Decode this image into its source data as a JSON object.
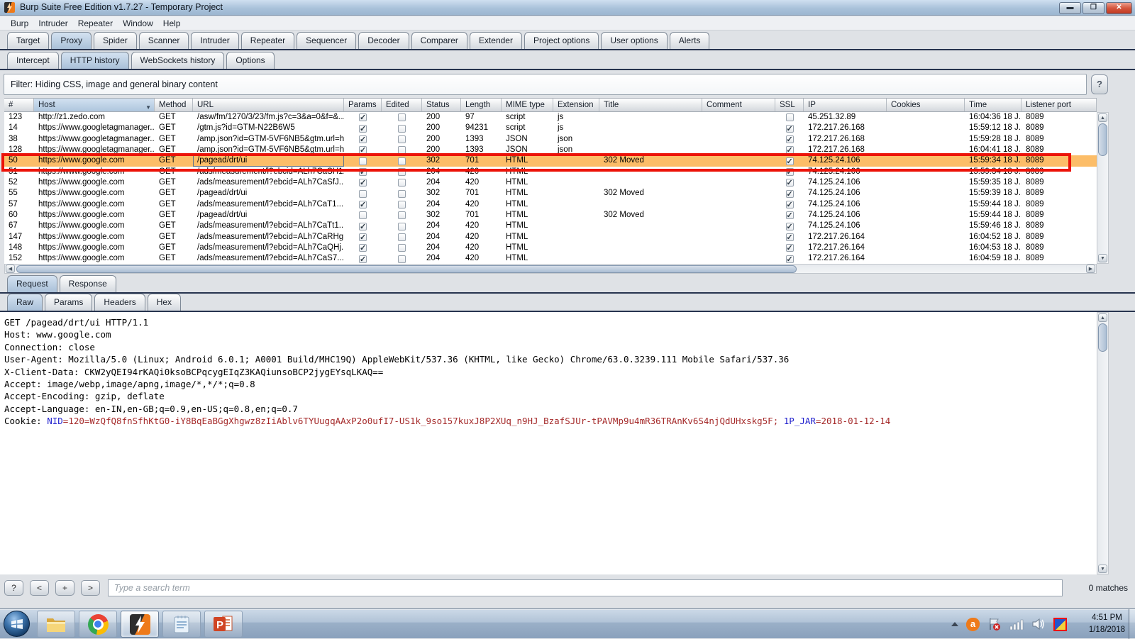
{
  "colors": {
    "selected_row": "#fcbd68",
    "annotation_red": "#ec1309",
    "tab_selected_blue": "#aec6dd",
    "cookie_name_blue": "#1f1fcd",
    "cookie_value_red": "#a52a2a",
    "titlebar_blue": "#a9c2da",
    "taskbar_blue": "#9bb0c8",
    "close_button_red": "#c13a22"
  },
  "window": {
    "title": "Burp Suite Free Edition v1.7.27 - Temporary Project"
  },
  "menu": {
    "items": [
      "Burp",
      "Intruder",
      "Repeater",
      "Window",
      "Help"
    ]
  },
  "main_tabs": {
    "items": [
      "Target",
      "Proxy",
      "Spider",
      "Scanner",
      "Intruder",
      "Repeater",
      "Sequencer",
      "Decoder",
      "Comparer",
      "Extender",
      "Project options",
      "User options",
      "Alerts"
    ],
    "selected": "Proxy"
  },
  "sub_tabs": {
    "items": [
      "Intercept",
      "HTTP history",
      "WebSockets history",
      "Options"
    ],
    "selected": "HTTP history"
  },
  "filter": {
    "label": "Filter: Hiding CSS, image and general binary content",
    "help_button": "?"
  },
  "http_table": {
    "columns": [
      "#",
      "Host",
      "Method",
      "URL",
      "Params",
      "Edited",
      "Status",
      "Length",
      "MIME type",
      "Extension",
      "Title",
      "Comment",
      "SSL",
      "IP",
      "Cookies",
      "Time",
      "Listener port"
    ],
    "sorted_column": "Host",
    "rows": [
      {
        "num": "123",
        "host": "http://z1.zedo.com",
        "method": "GET",
        "url": "/asw/fm/1270/3/23/fm.js?c=3&a=0&f=&...",
        "params": true,
        "edited": false,
        "status": "200",
        "length": "97",
        "mime": "script",
        "extension": "js",
        "title": "",
        "comment": "",
        "ssl": false,
        "ip": "45.251.32.89",
        "cookies": "",
        "time": "16:04:36 18 J...",
        "listener": "8089",
        "selected": false
      },
      {
        "num": "14",
        "host": "https://www.googletagmanager...",
        "method": "GET",
        "url": "/gtm.js?id=GTM-N22B6W5",
        "params": true,
        "edited": false,
        "status": "200",
        "length": "94231",
        "mime": "script",
        "extension": "js",
        "title": "",
        "comment": "",
        "ssl": true,
        "ip": "172.217.26.168",
        "cookies": "",
        "time": "15:59:12 18 J...",
        "listener": "8089",
        "selected": false
      },
      {
        "num": "38",
        "host": "https://www.googletagmanager...",
        "method": "GET",
        "url": "/amp.json?id=GTM-5VF6NB5&gtm.url=h...",
        "params": true,
        "edited": false,
        "status": "200",
        "length": "1393",
        "mime": "JSON",
        "extension": "json",
        "title": "",
        "comment": "",
        "ssl": true,
        "ip": "172.217.26.168",
        "cookies": "",
        "time": "15:59:28 18 J...",
        "listener": "8089",
        "selected": false
      },
      {
        "num": "128",
        "host": "https://www.googletagmanager...",
        "method": "GET",
        "url": "/amp.json?id=GTM-5VF6NB5&gtm.url=h",
        "params": true,
        "edited": false,
        "status": "200",
        "length": "1393",
        "mime": "JSON",
        "extension": "json",
        "title": "",
        "comment": "",
        "ssl": true,
        "ip": "172.217.26.168",
        "cookies": "",
        "time": "16:04:41 18 J...",
        "listener": "8089",
        "selected": false
      },
      {
        "num": "50",
        "host": "https://www.google.com",
        "method": "GET",
        "url": "/pagead/drt/ui",
        "params": false,
        "edited": false,
        "status": "302",
        "length": "701",
        "mime": "HTML",
        "extension": "",
        "title": "302 Moved",
        "comment": "",
        "ssl": true,
        "ip": "74.125.24.106",
        "cookies": "",
        "time": "15:59:34 18 J...",
        "listener": "8089",
        "selected": true
      },
      {
        "num": "51",
        "host": "https://www.google.com",
        "method": "GET",
        "url": "/ads/measurement/l?ebcid=ALh7CaSH1...",
        "params": true,
        "edited": false,
        "status": "204",
        "length": "420",
        "mime": "HTML",
        "extension": "",
        "title": "",
        "comment": "",
        "ssl": true,
        "ip": "74.125.24.106",
        "cookies": "",
        "time": "15:59:34 18 J...",
        "listener": "8089",
        "selected": false
      },
      {
        "num": "52",
        "host": "https://www.google.com",
        "method": "GET",
        "url": "/ads/measurement/l?ebcid=ALh7CaSfJ...",
        "params": true,
        "edited": false,
        "status": "204",
        "length": "420",
        "mime": "HTML",
        "extension": "",
        "title": "",
        "comment": "",
        "ssl": true,
        "ip": "74.125.24.106",
        "cookies": "",
        "time": "15:59:35 18 J...",
        "listener": "8089",
        "selected": false
      },
      {
        "num": "55",
        "host": "https://www.google.com",
        "method": "GET",
        "url": "/pagead/drt/ui",
        "params": false,
        "edited": false,
        "status": "302",
        "length": "701",
        "mime": "HTML",
        "extension": "",
        "title": "302 Moved",
        "comment": "",
        "ssl": true,
        "ip": "74.125.24.106",
        "cookies": "",
        "time": "15:59:39 18 J...",
        "listener": "8089",
        "selected": false
      },
      {
        "num": "57",
        "host": "https://www.google.com",
        "method": "GET",
        "url": "/ads/measurement/l?ebcid=ALh7CaT1...",
        "params": true,
        "edited": false,
        "status": "204",
        "length": "420",
        "mime": "HTML",
        "extension": "",
        "title": "",
        "comment": "",
        "ssl": true,
        "ip": "74.125.24.106",
        "cookies": "",
        "time": "15:59:44 18 J...",
        "listener": "8089",
        "selected": false
      },
      {
        "num": "60",
        "host": "https://www.google.com",
        "method": "GET",
        "url": "/pagead/drt/ui",
        "params": false,
        "edited": false,
        "status": "302",
        "length": "701",
        "mime": "HTML",
        "extension": "",
        "title": "302 Moved",
        "comment": "",
        "ssl": true,
        "ip": "74.125.24.106",
        "cookies": "",
        "time": "15:59:44 18 J...",
        "listener": "8089",
        "selected": false
      },
      {
        "num": "67",
        "host": "https://www.google.com",
        "method": "GET",
        "url": "/ads/measurement/l?ebcid=ALh7CaTt1...",
        "params": true,
        "edited": false,
        "status": "204",
        "length": "420",
        "mime": "HTML",
        "extension": "",
        "title": "",
        "comment": "",
        "ssl": true,
        "ip": "74.125.24.106",
        "cookies": "",
        "time": "15:59:46 18 J...",
        "listener": "8089",
        "selected": false
      },
      {
        "num": "147",
        "host": "https://www.google.com",
        "method": "GET",
        "url": "/ads/measurement/l?ebcid=ALh7CaRHg...",
        "params": true,
        "edited": false,
        "status": "204",
        "length": "420",
        "mime": "HTML",
        "extension": "",
        "title": "",
        "comment": "",
        "ssl": true,
        "ip": "172.217.26.164",
        "cookies": "",
        "time": "16:04:52 18 J...",
        "listener": "8089",
        "selected": false
      },
      {
        "num": "148",
        "host": "https://www.google.com",
        "method": "GET",
        "url": "/ads/measurement/l?ebcid=ALh7CaQHj...",
        "params": true,
        "edited": false,
        "status": "204",
        "length": "420",
        "mime": "HTML",
        "extension": "",
        "title": "",
        "comment": "",
        "ssl": true,
        "ip": "172.217.26.164",
        "cookies": "",
        "time": "16:04:53 18 J...",
        "listener": "8089",
        "selected": false
      },
      {
        "num": "152",
        "host": "https://www.google.com",
        "method": "GET",
        "url": "/ads/measurement/l?ebcid=ALh7CaS7...",
        "params": true,
        "edited": false,
        "status": "204",
        "length": "420",
        "mime": "HTML",
        "extension": "",
        "title": "",
        "comment": "",
        "ssl": true,
        "ip": "172.217.26.164",
        "cookies": "",
        "time": "16:04:59 18 J...",
        "listener": "8089",
        "selected": false
      }
    ]
  },
  "message_editor": {
    "tabs": [
      "Request",
      "Response"
    ],
    "selected_tab": "Request",
    "view_tabs": [
      "Raw",
      "Params",
      "Headers",
      "Hex"
    ],
    "selected_view": "Raw",
    "request_lines": [
      [
        {
          "t": "GET /pagead/drt/ui HTTP/1.1"
        }
      ],
      [
        {
          "t": "Host: www.google.com"
        }
      ],
      [
        {
          "t": "Connection: close"
        }
      ],
      [
        {
          "t": "User-Agent: Mozilla/5.0 (Linux; Android 6.0.1; A0001 Build/MHC19Q) AppleWebKit/537.36 (KHTML, like Gecko) Chrome/63.0.3239.111 Mobile Safari/537.36"
        }
      ],
      [
        {
          "t": "X-Client-Data: CKW2yQEI94rKAQi0ksoBCPqcygEIqZ3KAQiunsoBCP2jygEYsqLKAQ=="
        }
      ],
      [
        {
          "t": "Accept: image/webp,image/apng,image/*,*/*;q=0.8"
        }
      ],
      [
        {
          "t": "Accept-Encoding: gzip, deflate"
        }
      ],
      [
        {
          "t": "Accept-Language: en-IN,en-GB;q=0.9,en-US;q=0.8,en;q=0.7"
        }
      ],
      [
        {
          "t": "Cookie: "
        },
        {
          "t": "NID",
          "c": "name"
        },
        {
          "t": "=120=WzQfQ8fnSfhKtG0-iY8BqEaBGgXhgwz8zIiAblv6TYUugqAAxP2o0ufI7-US1k_9so157kuxJ8P2XUq_n9HJ_BzafSJUr-tPAVMp9u4mR36TRAnKv6S4njQdUHxskg5F; ",
          "c": "value"
        },
        {
          "t": "1P_JAR",
          "c": "name"
        },
        {
          "t": "=2018-01-12-14",
          "c": "value"
        }
      ]
    ]
  },
  "search": {
    "buttons": [
      "?",
      "<",
      "+",
      ">"
    ],
    "placeholder": "Type a search term",
    "matches": "0 matches"
  },
  "taskbar": {
    "apps": [
      "windows-start",
      "file-explorer",
      "chrome",
      "burp-suite",
      "notepad",
      "powerpoint"
    ],
    "active_app": "burp-suite",
    "tray_icons": [
      "hidden-icons-chevron",
      "avast-antivirus",
      "action-center-flag",
      "network-signal",
      "volume-speaker",
      "vnc-viewer"
    ],
    "avast_letter": "a",
    "clock_time": "4:51 PM",
    "clock_date": "1/18/2018"
  }
}
